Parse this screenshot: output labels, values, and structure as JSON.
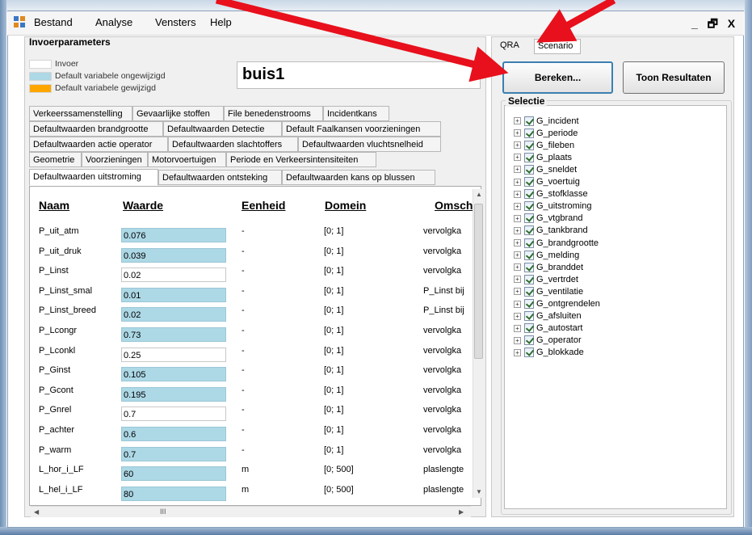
{
  "menu": [
    "Bestand",
    "Analyse",
    "Vensters",
    "Help"
  ],
  "window_controls": "_ Ё X",
  "left_panel": {
    "title": "Invoerparameters",
    "legend": [
      {
        "label": "Invoer",
        "color": "#ffffff"
      },
      {
        "label": "Default variabele ongewijzigd",
        "color": "#add8e6"
      },
      {
        "label": "Default variabele gewijzigd",
        "color": "#ffa500"
      }
    ],
    "case_name": "buis1",
    "tab_rows": [
      [
        "Verkeerssamenstelling",
        "Gevaarlijke stoffen",
        "File benedenstrooms",
        "Incidentkans"
      ],
      [
        "Defaultwaarden brandgrootte",
        "Defaultwaarden Detectie",
        "Default Faalkansen voorzieningen"
      ],
      [
        "Defaultwaarden actie operator",
        "Defaultwaarden slachtoffers",
        "Defaultwaarden vluchtsnelheid"
      ],
      [
        "Geometrie",
        "Voorzieningen",
        "Motorvoertuigen",
        "Periode en Verkeersintensiteiten"
      ],
      [
        "Defaultwaarden uitstroming",
        "Defaultwaarden ontsteking",
        "Defaultwaarden kans op blussen"
      ]
    ],
    "selected_tab": "Defaultwaarden uitstroming",
    "grid_headers": [
      "Naam",
      "Waarde",
      "Eenheid",
      "Domein",
      "Omsch"
    ],
    "rows": [
      {
        "naam": "P_uit_atm",
        "waarde": "0.076",
        "eenheid": "-",
        "domein": "[0; 1]",
        "omsch": "vervolgka",
        "changed": true
      },
      {
        "naam": "P_uit_druk",
        "waarde": "0.039",
        "eenheid": "-",
        "domein": "[0; 1]",
        "omsch": "vervolgka",
        "changed": true
      },
      {
        "naam": "P_Linst",
        "waarde": "0.02",
        "eenheid": "-",
        "domein": "[0; 1]",
        "omsch": "vervolgka",
        "changed": false
      },
      {
        "naam": "P_Linst_smal",
        "waarde": "0.01",
        "eenheid": "-",
        "domein": "[0; 1]",
        "omsch": "P_Linst bij",
        "changed": true
      },
      {
        "naam": "P_Linst_breed",
        "waarde": "0.02",
        "eenheid": "-",
        "domein": "[0; 1]",
        "omsch": "P_Linst bij",
        "changed": true
      },
      {
        "naam": "P_Lcongr",
        "waarde": "0.73",
        "eenheid": "-",
        "domein": "[0; 1]",
        "omsch": "vervolgka",
        "changed": true
      },
      {
        "naam": "P_Lconkl",
        "waarde": "0.25",
        "eenheid": "-",
        "domein": "[0; 1]",
        "omsch": "vervolgka",
        "changed": false
      },
      {
        "naam": "P_Ginst",
        "waarde": "0.105",
        "eenheid": "-",
        "domein": "[0; 1]",
        "omsch": "vervolgka",
        "changed": true
      },
      {
        "naam": "P_Gcont",
        "waarde": "0.195",
        "eenheid": "-",
        "domein": "[0; 1]",
        "omsch": "vervolgka",
        "changed": true
      },
      {
        "naam": "P_Gnrel",
        "waarde": "0.7",
        "eenheid": "-",
        "domein": "[0; 1]",
        "omsch": "vervolgka",
        "changed": false
      },
      {
        "naam": "P_achter",
        "waarde": "0.6",
        "eenheid": "-",
        "domein": "[0; 1]",
        "omsch": "vervolgka",
        "changed": true
      },
      {
        "naam": "P_warm",
        "waarde": "0.7",
        "eenheid": "-",
        "domein": "[0; 1]",
        "omsch": "vervolgka",
        "changed": true
      },
      {
        "naam": "L_hor_i_LF",
        "waarde": "60",
        "eenheid": "m",
        "domein": "[0; 500]",
        "omsch": "plaslengte",
        "changed": true
      },
      {
        "naam": "L_hel_i_LF",
        "waarde": "80",
        "eenheid": "m",
        "domein": "[0; 500]",
        "omsch": "plaslengte",
        "changed": true
      }
    ],
    "hscroll_thumb": "III"
  },
  "right_panel": {
    "tabs": [
      "QRA",
      "Scenario"
    ],
    "selected_tab": "QRA",
    "buttons": {
      "bereken": "Bereken...",
      "toon": "Toon Resultaten"
    },
    "selection_title": "Selectie",
    "tree_items": [
      "G_incident",
      "G_periode",
      "G_fileben",
      "G_plaats",
      "G_sneldet",
      "G_voertuig",
      "G_stofklasse",
      "G_uitstroming",
      "G_vtgbrand",
      "G_tankbrand",
      "G_brandgrootte",
      "G_melding",
      "G_branddet",
      "G_vertrdet",
      "G_ventilatie",
      "G_ontgrendelen",
      "G_afsluiten",
      "G_autostart",
      "G_operator",
      "G_blokkade"
    ]
  },
  "colors": {
    "changed_cell": "#add8e6",
    "annotation_arrow": "#e8101c",
    "default_changed": "#ffa500"
  }
}
